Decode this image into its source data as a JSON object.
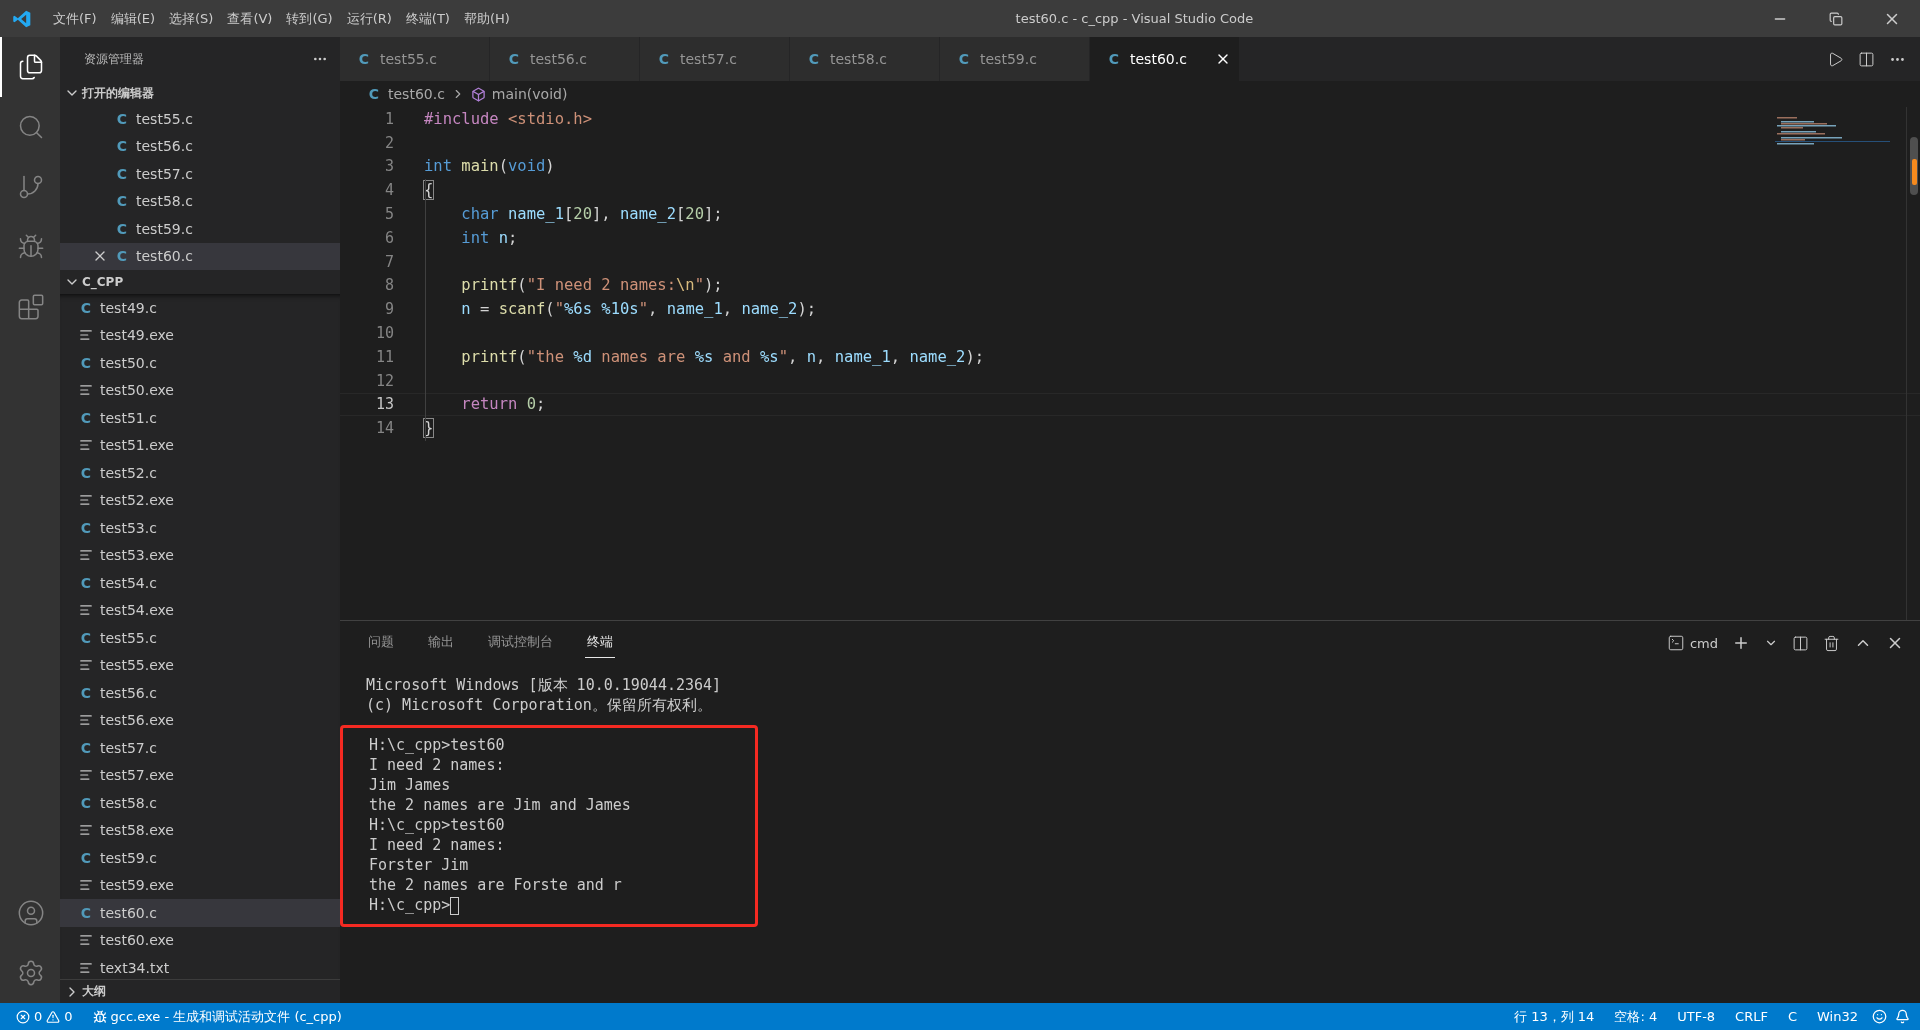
{
  "window": {
    "title": "test60.c - c_cpp - Visual Studio Code"
  },
  "menu": [
    "文件(F)",
    "编辑(E)",
    "选择(S)",
    "查看(V)",
    "转到(G)",
    "运行(R)",
    "终端(T)",
    "帮助(H)"
  ],
  "activity_bar": [
    {
      "kind": "files",
      "selected": true
    },
    {
      "kind": "search",
      "selected": false
    },
    {
      "kind": "git",
      "selected": false
    },
    {
      "kind": "debug",
      "selected": false
    },
    {
      "kind": "extensions",
      "selected": false
    }
  ],
  "sidebar": {
    "title": "资源管理器",
    "open_editors": {
      "title": "打开的编辑器",
      "expanded": true,
      "items": [
        {
          "name": "test55.c",
          "glyph": "C",
          "selected": false
        },
        {
          "name": "test56.c",
          "glyph": "C",
          "selected": false
        },
        {
          "name": "test57.c",
          "glyph": "C",
          "selected": false
        },
        {
          "name": "test58.c",
          "glyph": "C",
          "selected": false
        },
        {
          "name": "test59.c",
          "glyph": "C",
          "selected": false
        },
        {
          "name": "test60.c",
          "glyph": "C",
          "selected": true
        }
      ]
    },
    "folder": {
      "title": "C_CPP",
      "expanded": true,
      "items": [
        {
          "name": "test49.c",
          "kind": "c",
          "glyph": "C",
          "selected": false
        },
        {
          "name": "test49.exe",
          "kind": "exe",
          "selected": false
        },
        {
          "name": "test50.c",
          "kind": "c",
          "glyph": "C",
          "selected": false
        },
        {
          "name": "test50.exe",
          "kind": "exe",
          "selected": false
        },
        {
          "name": "test51.c",
          "kind": "c",
          "glyph": "C",
          "selected": false
        },
        {
          "name": "test51.exe",
          "kind": "exe",
          "selected": false
        },
        {
          "name": "test52.c",
          "kind": "c",
          "glyph": "C",
          "selected": false
        },
        {
          "name": "test52.exe",
          "kind": "exe",
          "selected": false
        },
        {
          "name": "test53.c",
          "kind": "c",
          "glyph": "C",
          "selected": false
        },
        {
          "name": "test53.exe",
          "kind": "exe",
          "selected": false
        },
        {
          "name": "test54.c",
          "kind": "c",
          "glyph": "C",
          "selected": false
        },
        {
          "name": "test54.exe",
          "kind": "exe",
          "selected": false
        },
        {
          "name": "test55.c",
          "kind": "c",
          "glyph": "C",
          "selected": false
        },
        {
          "name": "test55.exe",
          "kind": "exe",
          "selected": false
        },
        {
          "name": "test56.c",
          "kind": "c",
          "glyph": "C",
          "selected": false
        },
        {
          "name": "test56.exe",
          "kind": "exe",
          "selected": false
        },
        {
          "name": "test57.c",
          "kind": "c",
          "glyph": "C",
          "selected": false
        },
        {
          "name": "test57.exe",
          "kind": "exe",
          "selected": false
        },
        {
          "name": "test58.c",
          "kind": "c",
          "glyph": "C",
          "selected": false
        },
        {
          "name": "test58.exe",
          "kind": "exe",
          "selected": false
        },
        {
          "name": "test59.c",
          "kind": "c",
          "glyph": "C",
          "selected": false
        },
        {
          "name": "test59.exe",
          "kind": "exe",
          "selected": false
        },
        {
          "name": "test60.c",
          "kind": "c",
          "glyph": "C",
          "selected": true
        },
        {
          "name": "test60.exe",
          "kind": "exe",
          "selected": false
        },
        {
          "name": "text34.txt",
          "kind": "txt",
          "selected": false
        }
      ]
    },
    "outline": {
      "title": "大纲",
      "expanded": false
    }
  },
  "tabs": [
    {
      "name": "test55.c",
      "glyph": "C",
      "selected": false
    },
    {
      "name": "test56.c",
      "glyph": "C",
      "selected": false
    },
    {
      "name": "test57.c",
      "glyph": "C",
      "selected": false
    },
    {
      "name": "test58.c",
      "glyph": "C",
      "selected": false
    },
    {
      "name": "test59.c",
      "glyph": "C",
      "selected": false
    },
    {
      "name": "test60.c",
      "glyph": "C",
      "selected": true
    }
  ],
  "breadcrumb": {
    "file": "test60.c",
    "glyph": "C",
    "symbol": "main(void)"
  },
  "code": [
    {
      "number": "1",
      "current": false,
      "tokens": [
        {
          "kind": "directive",
          "text": "#include "
        },
        {
          "kind": "string",
          "text": "<stdio.h>"
        }
      ]
    },
    {
      "number": "2",
      "current": false
    },
    {
      "number": "3",
      "current": false,
      "tokens": [
        {
          "kind": "keyword",
          "text": "int "
        },
        {
          "kind": "func",
          "text": "main"
        },
        {
          "kind": "plain",
          "text": "("
        },
        {
          "kind": "keyword",
          "text": "void"
        },
        {
          "kind": "plain",
          "text": ")"
        }
      ]
    },
    {
      "number": "4",
      "current": false,
      "tokens": [
        {
          "kind": "bracket",
          "text": "{"
        }
      ]
    },
    {
      "number": "5",
      "current": false,
      "tokens": [
        {
          "kind": "keyword",
          "text": "    char "
        },
        {
          "kind": "var",
          "text": "name_1"
        },
        {
          "kind": "plain",
          "text": "["
        },
        {
          "kind": "number",
          "text": "20"
        },
        {
          "kind": "plain",
          "text": "], "
        },
        {
          "kind": "var",
          "text": "name_2"
        },
        {
          "kind": "plain",
          "text": "["
        },
        {
          "kind": "number",
          "text": "20"
        },
        {
          "kind": "plain",
          "text": "];"
        }
      ]
    },
    {
      "number": "6",
      "current": false,
      "tokens": [
        {
          "kind": "keyword",
          "text": "    int "
        },
        {
          "kind": "var",
          "text": "n"
        },
        {
          "kind": "plain",
          "text": ";"
        }
      ]
    },
    {
      "number": "7",
      "current": false
    },
    {
      "number": "8",
      "current": false,
      "tokens": [
        {
          "kind": "func",
          "text": "    printf"
        },
        {
          "kind": "plain",
          "text": "("
        },
        {
          "kind": "string",
          "text": "\"I need 2 names:"
        },
        {
          "kind": "escape",
          "text": "\\n"
        },
        {
          "kind": "string",
          "text": "\""
        },
        {
          "kind": "plain",
          "text": ");"
        }
      ]
    },
    {
      "number": "9",
      "current": false,
      "tokens": [
        {
          "kind": "var",
          "text": "    n"
        },
        {
          "kind": "plain",
          "text": " = "
        },
        {
          "kind": "func",
          "text": "scanf"
        },
        {
          "kind": "plain",
          "text": "("
        },
        {
          "kind": "string",
          "text": "\""
        },
        {
          "kind": "format",
          "text": "%6s"
        },
        {
          "kind": "format",
          "text": " %10s"
        },
        {
          "kind": "string",
          "text": "\""
        },
        {
          "kind": "plain",
          "text": ", "
        },
        {
          "kind": "var",
          "text": "name_1"
        },
        {
          "kind": "plain",
          "text": ", "
        },
        {
          "kind": "var",
          "text": "name_2"
        },
        {
          "kind": "plain",
          "text": ");"
        }
      ]
    },
    {
      "number": "10",
      "current": false
    },
    {
      "number": "11",
      "current": false,
      "tokens": [
        {
          "kind": "func",
          "text": "    printf"
        },
        {
          "kind": "plain",
          "text": "("
        },
        {
          "kind": "string",
          "text": "\"the "
        },
        {
          "kind": "format",
          "text": "%d"
        },
        {
          "kind": "string",
          "text": " names are "
        },
        {
          "kind": "format",
          "text": "%s"
        },
        {
          "kind": "string",
          "text": " and "
        },
        {
          "kind": "format",
          "text": "%s"
        },
        {
          "kind": "string",
          "text": "\""
        },
        {
          "kind": "plain",
          "text": ", "
        },
        {
          "kind": "var",
          "text": "n"
        },
        {
          "kind": "plain",
          "text": ", "
        },
        {
          "kind": "var",
          "text": "name_1"
        },
        {
          "kind": "plain",
          "text": ", "
        },
        {
          "kind": "var",
          "text": "name_2"
        },
        {
          "kind": "plain",
          "text": ");"
        }
      ]
    },
    {
      "number": "12",
      "current": false
    },
    {
      "number": "13",
      "current": true,
      "tokens": [
        {
          "kind": "control",
          "text": "    return "
        },
        {
          "kind": "number",
          "text": "0"
        },
        {
          "kind": "plain",
          "text": ";"
        }
      ]
    },
    {
      "number": "14",
      "current": false,
      "tokens": [
        {
          "kind": "bracket",
          "text": "}"
        }
      ]
    }
  ],
  "panel": {
    "tabs": [
      {
        "label": "问题",
        "selected": false
      },
      {
        "label": "输出",
        "selected": false
      },
      {
        "label": "调试控制台",
        "selected": false
      },
      {
        "label": "终端",
        "selected": true
      }
    ],
    "shell": "cmd",
    "terminal": {
      "header": [
        "Microsoft Windows [版本 10.0.19044.2364]",
        "(c) Microsoft Corporation。保留所有权利。"
      ],
      "highlighted": [
        "H:\\c_cpp>test60",
        "I need 2 names:",
        "Jim James",
        "the 2 names are Jim and James",
        "H:\\c_cpp>test60",
        "I need 2 names:",
        "Forster Jim",
        "the 2 names are Forste and r",
        "H:\\c_cpp>"
      ]
    }
  },
  "status_bar": {
    "errors": "0",
    "warnings": "0",
    "task": "gcc.exe - 生成和调试活动文件 (c_cpp)",
    "right": [
      "行 13，列 14",
      "空格: 4",
      "UTF-8",
      "CRLF",
      "C",
      "Win32"
    ]
  }
}
